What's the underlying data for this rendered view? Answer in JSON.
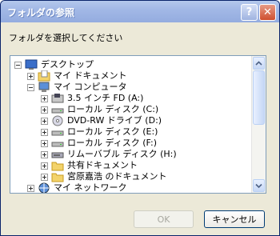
{
  "window": {
    "title": "フォルダの参照",
    "help_label": "?",
    "close_label": "✕"
  },
  "instruction": "フォルダを選択してください",
  "tree": {
    "items": [
      {
        "label": "デスクトップ",
        "icon": "desktop-icon",
        "expander": "minus"
      },
      {
        "label": "マイ ドキュメント",
        "icon": "documents-folder-icon",
        "expander": "plus"
      },
      {
        "label": "マイ コンピュータ",
        "icon": "computer-icon",
        "expander": "minus"
      },
      {
        "label": "3.5 インチ FD (A:)",
        "icon": "floppy-drive-icon",
        "expander": "plus"
      },
      {
        "label": "ローカル ディスク (C:)",
        "icon": "local-disk-icon",
        "expander": "plus"
      },
      {
        "label": "DVD-RW ドライブ (D:)",
        "icon": "dvd-drive-icon",
        "expander": "plus"
      },
      {
        "label": "ローカル ディスク (E:)",
        "icon": "local-disk-icon",
        "expander": "plus"
      },
      {
        "label": "ローカル ディスク (F:)",
        "icon": "local-disk-icon",
        "expander": "plus"
      },
      {
        "label": "リムーバブル ディスク (H:)",
        "icon": "removable-disk-icon",
        "expander": "plus"
      },
      {
        "label": "共有ドキュメント",
        "icon": "folder-icon",
        "expander": "plus"
      },
      {
        "label": "宮原嘉浩 のドキュメント",
        "icon": "folder-icon",
        "expander": "plus"
      },
      {
        "label": "マイ ネットワーク",
        "icon": "network-icon",
        "expander": "plus"
      }
    ]
  },
  "buttons": {
    "ok": "OK",
    "cancel": "キャンセル"
  },
  "colors": {
    "titlebar": "#a2b8e6",
    "dialog_bg": "#ece9d8",
    "tree_border": "#7f9db9"
  }
}
